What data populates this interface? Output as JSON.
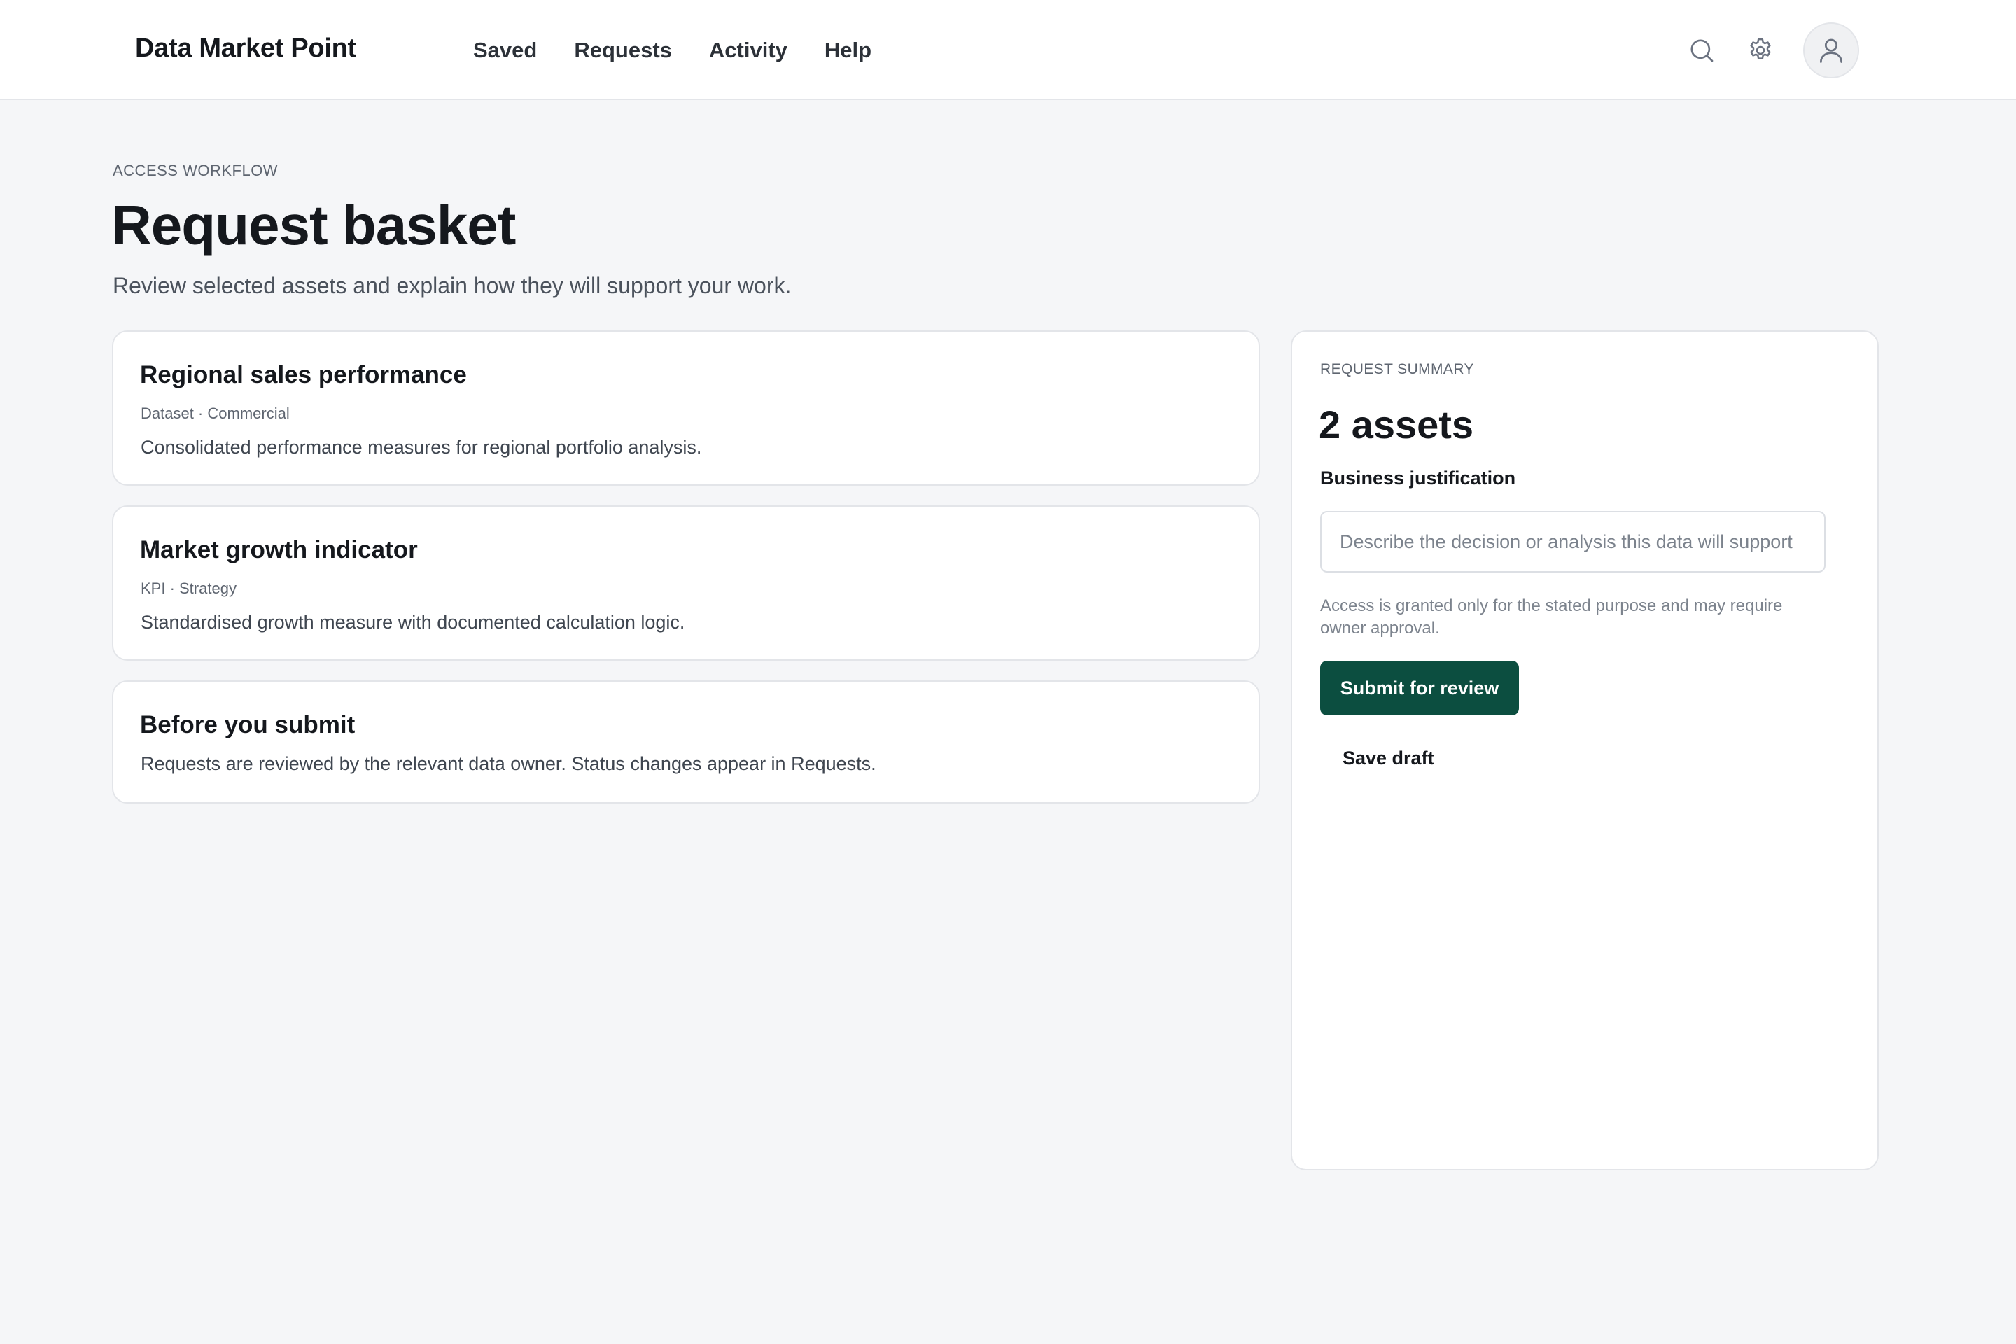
{
  "app": {
    "brand": "Data Market Point"
  },
  "nav": {
    "items": [
      {
        "label": "Saved"
      },
      {
        "label": "Requests"
      },
      {
        "label": "Activity"
      },
      {
        "label": "Help"
      }
    ]
  },
  "header_tools": {
    "search_icon": "search-icon",
    "settings_icon": "gear-icon",
    "avatar_icon": "user-icon"
  },
  "page": {
    "eyebrow": "ACCESS WORKFLOW",
    "title": "Request basket",
    "subtitle": "Review selected assets and explain how they will support your work."
  },
  "assets": [
    {
      "title": "Regional sales performance",
      "meta": "Dataset · Commercial",
      "description": "Consolidated performance measures for regional portfolio analysis."
    },
    {
      "title": "Market growth indicator",
      "meta": "KPI · Strategy",
      "description": "Standardised growth measure with documented calculation logic."
    }
  ],
  "notice": {
    "title": "Before you submit",
    "description": "Requests are reviewed by the relevant data owner. Status changes appear in Requests."
  },
  "summary": {
    "eyebrow": "REQUEST SUMMARY",
    "count_label": "2 assets",
    "field_label": "Business justification",
    "input_value": "",
    "input_placeholder": "Describe the decision or analysis this data will support",
    "helper_text": "Access is granted only for the stated purpose and may require owner approval.",
    "submit_label": "Submit for review",
    "draft_label": "Save draft"
  },
  "colors": {
    "background": "#f5f6f8",
    "surface": "#ffffff",
    "primary": "#0c4e40",
    "border": "#e3e5e9",
    "text": "#15181d",
    "muted": "#5e6570"
  }
}
